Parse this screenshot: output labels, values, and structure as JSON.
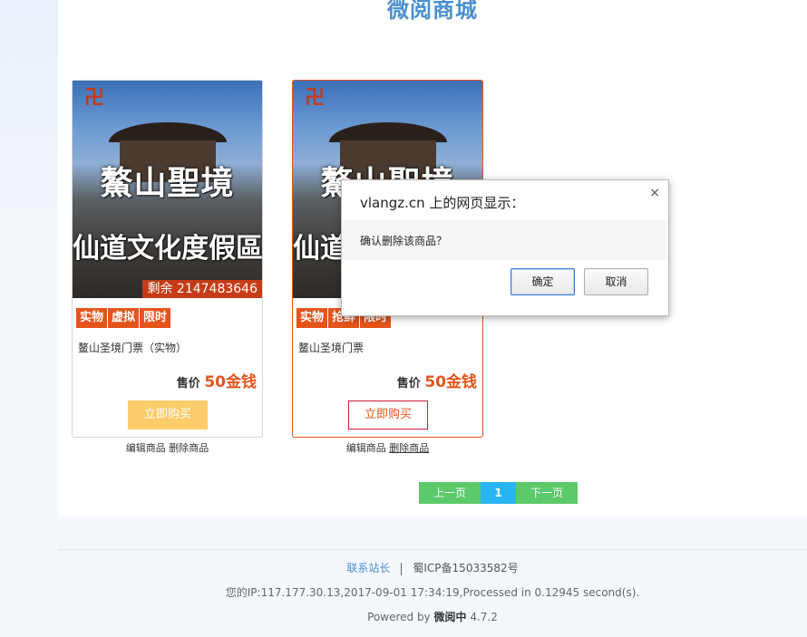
{
  "site": {
    "title": "微阅商城"
  },
  "products": [
    {
      "banner_line1": "鰲山聖境",
      "banner_line2": "仙道文化度假區",
      "remain": "剩余 2147483646",
      "tags": [
        "实物",
        "虚拟",
        "限时"
      ],
      "name": "鳌山圣境门票（实物）",
      "price_label": "售价",
      "price_value": "50金钱",
      "buy_label": "立即购买",
      "edit_label": "编辑商品",
      "delete_label": "删除商品"
    },
    {
      "banner_line1": "鰲山聖境",
      "banner_line2": "仙道文化度假區",
      "remain": "",
      "tags": [
        "实物",
        "抢鲜",
        "限时"
      ],
      "name": "鳌山圣境门票",
      "price_label": "售价",
      "price_value": "50金钱",
      "buy_label": "立即购买",
      "edit_label": "编辑商品",
      "delete_label": "删除商品"
    }
  ],
  "pager": {
    "prev": "上一页",
    "current": "1",
    "next": "下一页"
  },
  "footer": {
    "contact": "联系站长",
    "icp": "蜀ICP备15033582号",
    "ip_line": "您的IP:117.177.30.13,2017-09-01 17:34:19,Processed in 0.12945 second(s).",
    "powered_prefix": "Powered by",
    "powered_name": "微阅中",
    "powered_version": "4.7.2"
  },
  "dialog": {
    "title": "vlangz.cn 上的网页显示：",
    "message": "确认删除该商品？",
    "ok": "确定",
    "cancel": "取消",
    "close": "×"
  }
}
